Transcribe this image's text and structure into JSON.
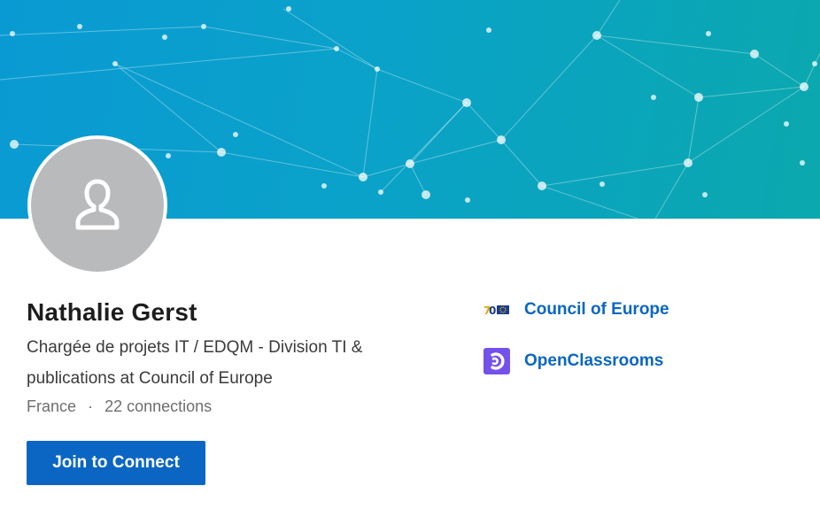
{
  "profile": {
    "name": "Nathalie Gerst",
    "headline": "Chargée de projets IT / EDQM - Division TI & publications at Council of Europe",
    "location": "France",
    "separator": "·",
    "connections": "22 connections"
  },
  "actions": {
    "join_label": "Join to Connect"
  },
  "organizations": [
    {
      "name": "Council of Europe",
      "icon": "council-of-europe-logo"
    },
    {
      "name": "OpenClassrooms",
      "icon": "openclassrooms-logo"
    }
  ],
  "colors": {
    "accent": "#0a66c2",
    "banner_start": "#0a9ad3",
    "banner_end": "#0ba8ae",
    "avatar_bg": "#b9babc",
    "openclassrooms": "#7451eb"
  }
}
